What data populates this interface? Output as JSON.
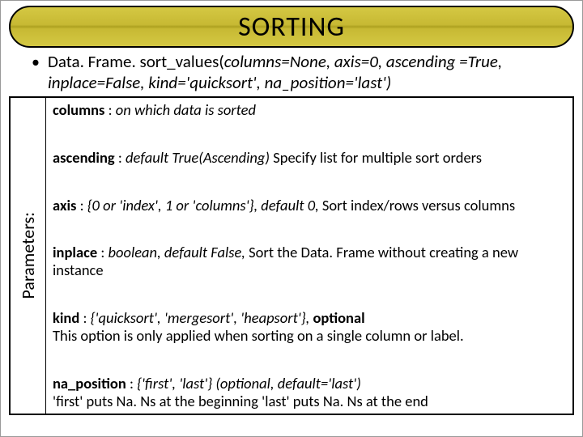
{
  "title": "SORTING",
  "signature": {
    "prefix": "Data. Frame. sort_values(",
    "args": "columns=None, axis=0, ascending =True, inplace=False, kind='quicksort', na_position='last')"
  },
  "side_label": "Parameters:",
  "params": [
    {
      "name": "columns",
      "sep": " : ",
      "ital": "on which data is sorted",
      "desc": ""
    },
    {
      "name": "ascending",
      "sep": " : ",
      "ital": "default True(Ascending) ",
      "desc": "Specify list for multiple sort orders"
    },
    {
      "name": "axis",
      "sep": " : ",
      "ital": "{0 or 'index', 1 or 'columns'}, default 0, ",
      "desc": "Sort index/rows versus columns"
    },
    {
      "name": "inplace",
      "sep": " : ",
      "ital": "boolean, default False, ",
      "desc": "Sort the Data. Frame without creating a new instance"
    },
    {
      "name": "kind",
      "sep": " : ",
      "ital": "{'quicksort', 'mergesort', 'heapsort'}, ",
      "bold2": "optional",
      "desc2": "This option is only applied when sorting on a single column or label."
    },
    {
      "name": "na_position",
      "sep": " : ",
      "ital": "{'first', 'last'} (optional, default='last')",
      "desc2": "'first' puts Na. Ns at the beginning 'last' puts Na. Ns at the end"
    }
  ]
}
